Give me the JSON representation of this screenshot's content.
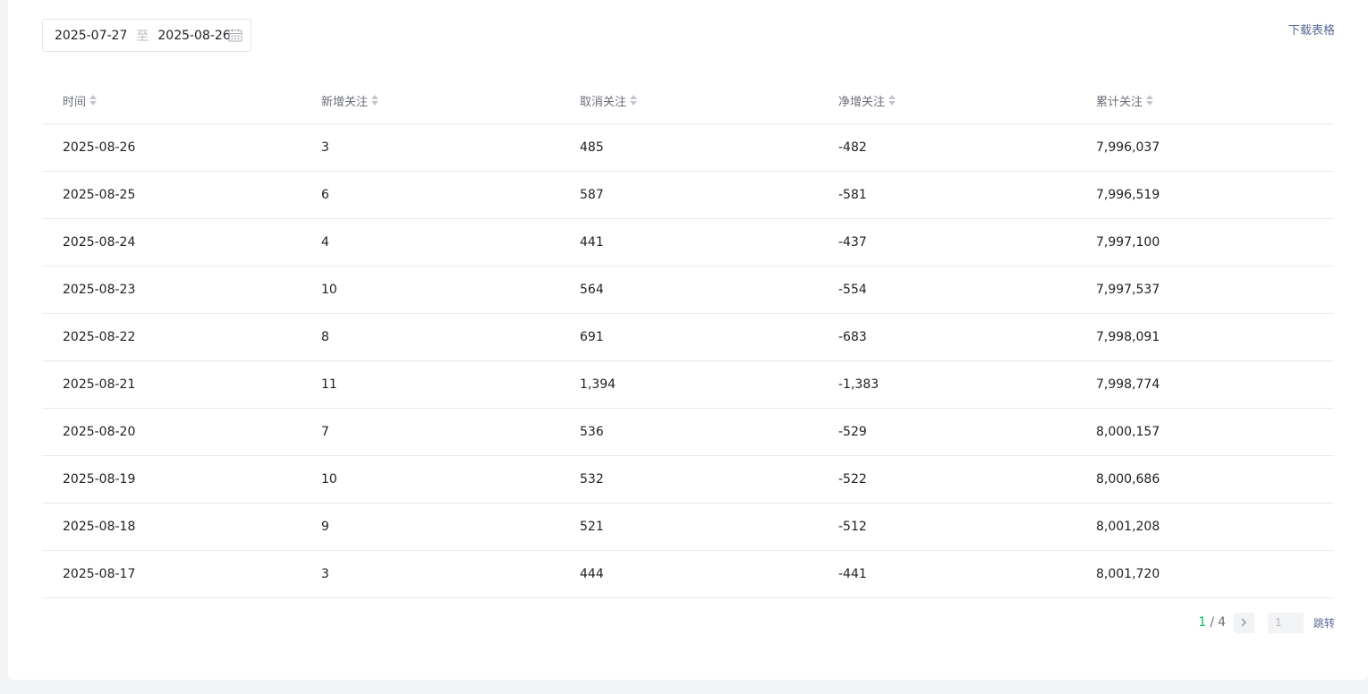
{
  "date_range": {
    "start": "2025-07-27",
    "separator": "至",
    "end": "2025-08-26"
  },
  "download_label": "下载表格",
  "table": {
    "columns": [
      "时间",
      "新增关注",
      "取消关注",
      "净增关注",
      "累计关注"
    ],
    "rows": [
      [
        "2025-08-26",
        "3",
        "485",
        "-482",
        "7,996,037"
      ],
      [
        "2025-08-25",
        "6",
        "587",
        "-581",
        "7,996,519"
      ],
      [
        "2025-08-24",
        "4",
        "441",
        "-437",
        "7,997,100"
      ],
      [
        "2025-08-23",
        "10",
        "564",
        "-554",
        "7,997,537"
      ],
      [
        "2025-08-22",
        "8",
        "691",
        "-683",
        "7,998,091"
      ],
      [
        "2025-08-21",
        "11",
        "1,394",
        "-1,383",
        "7,998,774"
      ],
      [
        "2025-08-20",
        "7",
        "536",
        "-529",
        "8,000,157"
      ],
      [
        "2025-08-19",
        "10",
        "532",
        "-522",
        "8,000,686"
      ],
      [
        "2025-08-18",
        "9",
        "521",
        "-512",
        "8,001,208"
      ],
      [
        "2025-08-17",
        "3",
        "444",
        "-441",
        "8,001,720"
      ]
    ]
  },
  "pagination": {
    "current": "1",
    "separator": "/",
    "total": "4",
    "input_placeholder": "1",
    "jump_label": "跳转"
  },
  "icons": {
    "calendar": "calendar-icon",
    "sort": "sort-icon",
    "next": "chevron-right-icon"
  },
  "colors": {
    "accent": "#07c160",
    "link": "#576b95",
    "border": "#e8e9ec"
  }
}
